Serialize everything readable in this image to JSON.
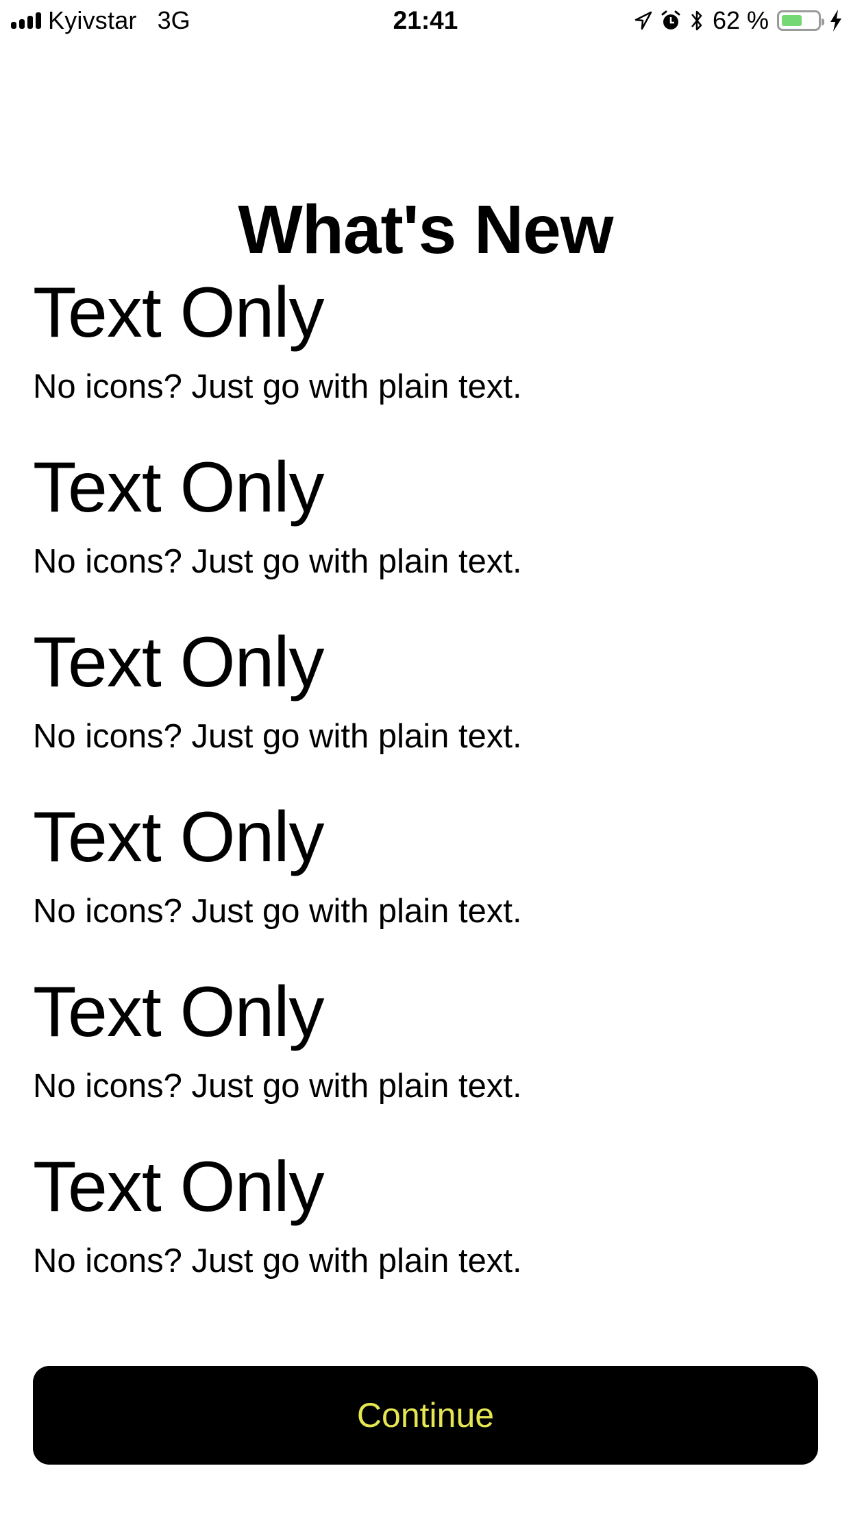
{
  "status_bar": {
    "carrier": "Kyivstar",
    "network": "3G",
    "time": "21:41",
    "battery_percent_label": "62 %",
    "battery_level": 0.62,
    "signal_bars": 4,
    "icons": [
      "signal-icon",
      "location-arrow-icon",
      "alarm-icon",
      "bluetooth-icon",
      "battery-icon",
      "charging-bolt-icon"
    ],
    "battery_fill_color": "#74d874"
  },
  "header": {
    "title": "What's New"
  },
  "features": [
    {
      "title": "Text Only",
      "description": "No icons? Just go with plain text."
    },
    {
      "title": "Text Only",
      "description": "No icons? Just go with plain text."
    },
    {
      "title": "Text Only",
      "description": "No icons? Just go with plain text."
    },
    {
      "title": "Text Only",
      "description": "No icons? Just go with plain text."
    },
    {
      "title": "Text Only",
      "description": "No icons? Just go with plain text."
    },
    {
      "title": "Text Only",
      "description": "No icons? Just go with plain text."
    }
  ],
  "continue_button": {
    "label": "Continue",
    "background_color": "#000000",
    "text_color": "#e6e651"
  }
}
